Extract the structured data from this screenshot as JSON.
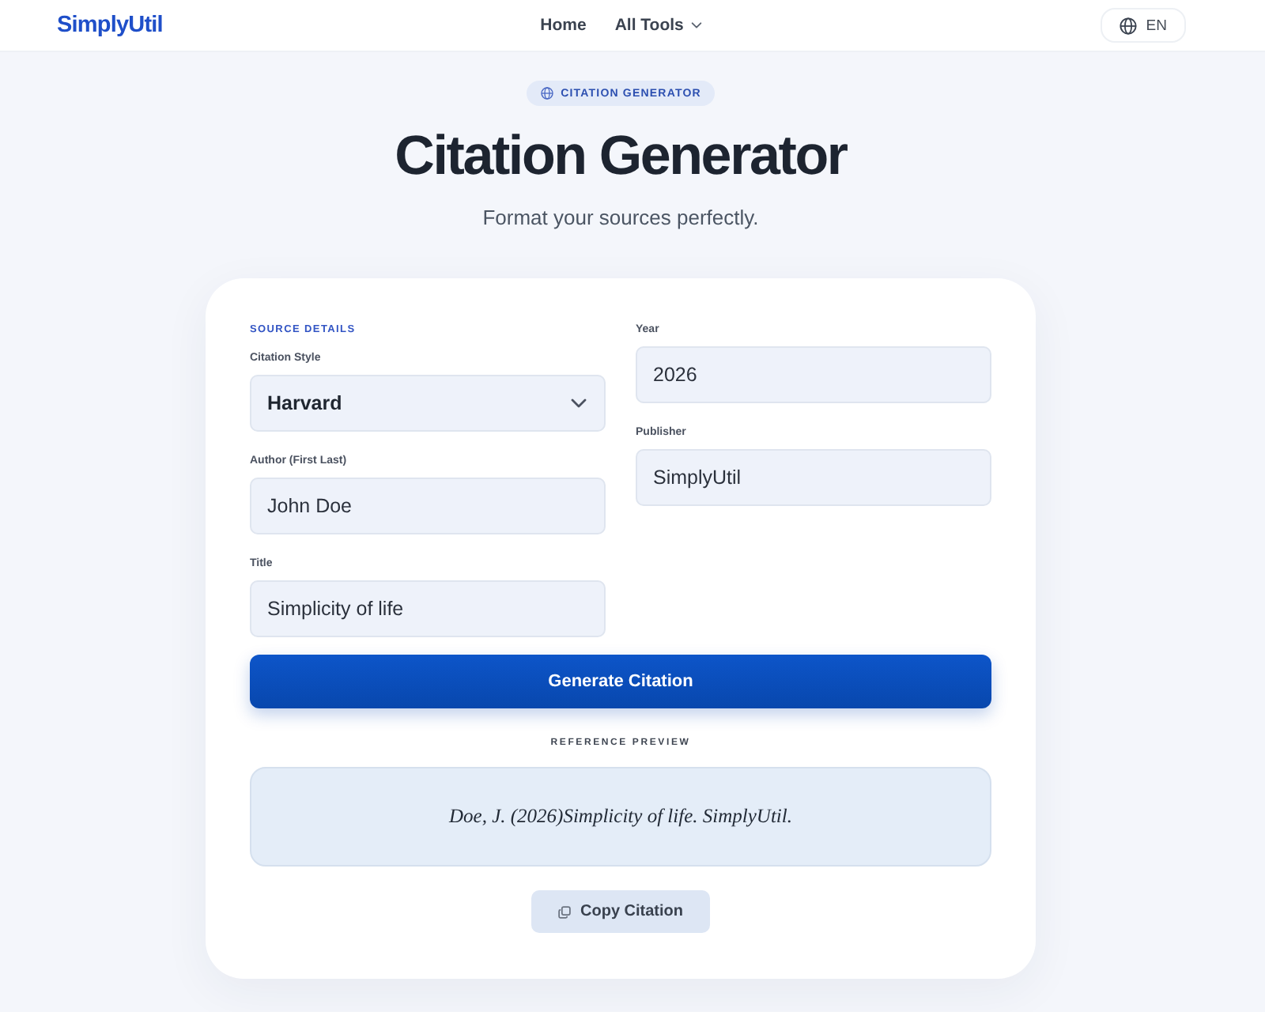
{
  "header": {
    "logo": "SimplyUtil",
    "nav": [
      {
        "kind": "link",
        "label": "Home"
      },
      {
        "kind": "dropdown",
        "label": "All Tools"
      }
    ],
    "language": "EN"
  },
  "hero": {
    "badge": "CITATION GENERATOR",
    "title": "Citation Generator",
    "subtitle": "Format your sources perfectly."
  },
  "form": {
    "section_label": "SOURCE DETAILS",
    "columns": [
      {
        "fields": [
          {
            "kind": "select",
            "label": "Citation Style",
            "value": "Harvard"
          },
          {
            "kind": "text",
            "label": "Author (First Last)",
            "value": "John Doe"
          },
          {
            "kind": "text",
            "label": "Title",
            "value": "Simplicity of life"
          }
        ]
      },
      {
        "fields": [
          {
            "kind": "text",
            "label": "Year",
            "value": "2026"
          },
          {
            "kind": "text",
            "label": "Publisher",
            "value": "SimplyUtil"
          }
        ]
      }
    ],
    "submit_button": "Generate Citation"
  },
  "preview": {
    "label": "REFERENCE PREVIEW",
    "citation": "Doe, J. (2026)Simplicity of life. SimplyUtil.",
    "copy_button": "Copy Citation"
  }
}
